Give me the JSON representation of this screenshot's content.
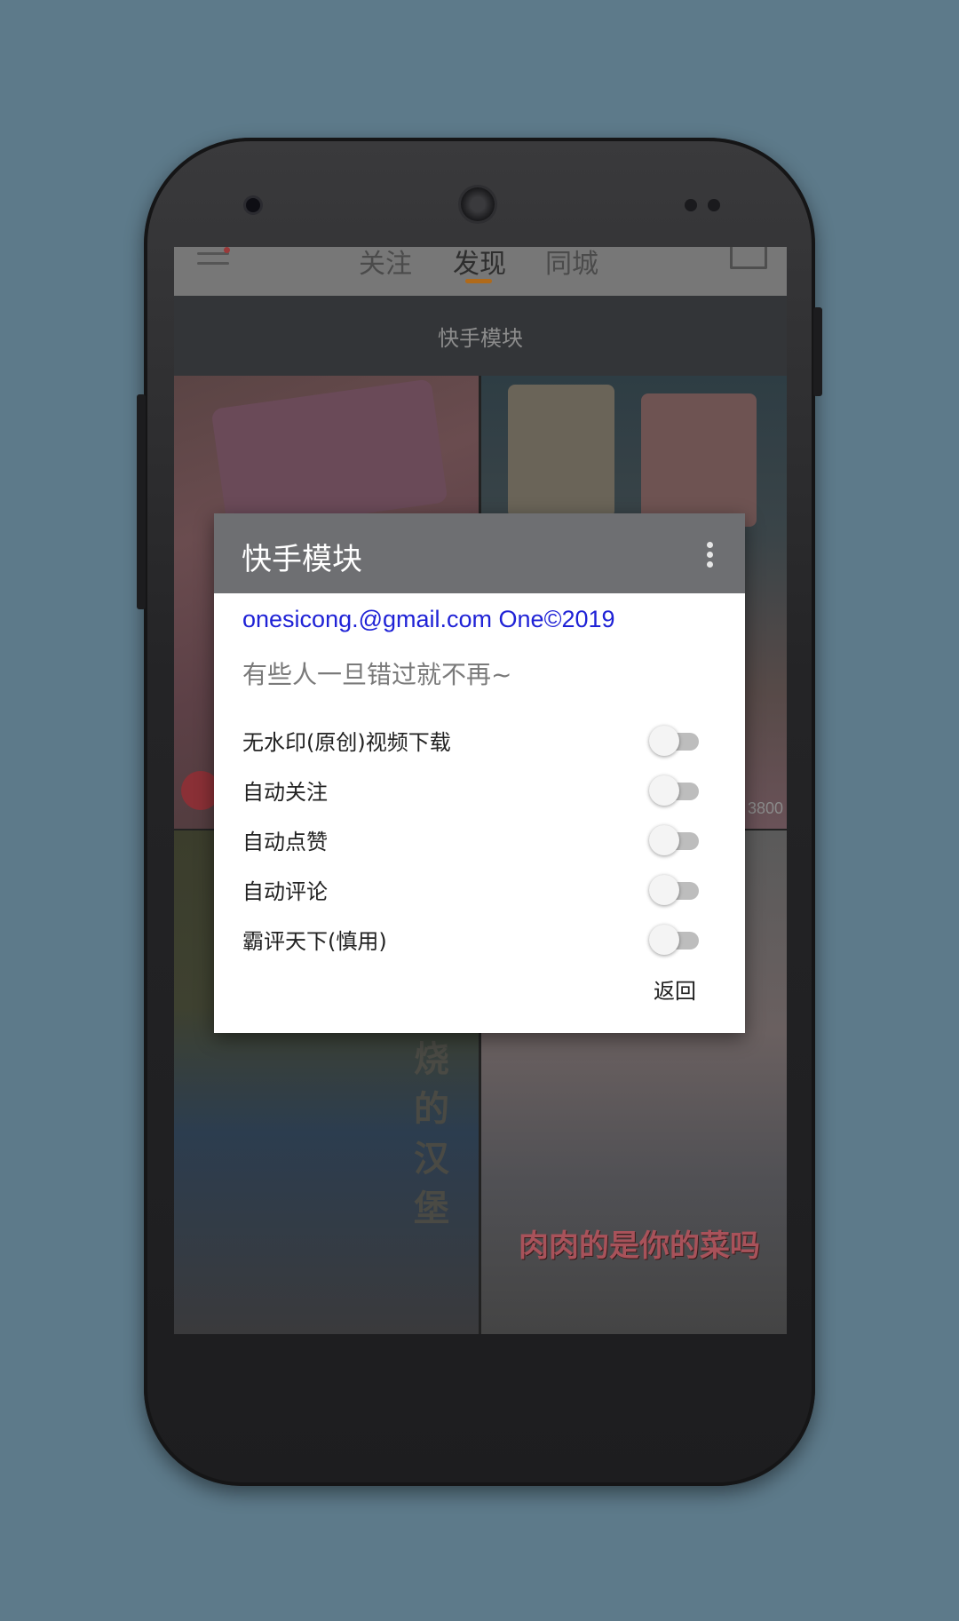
{
  "app_header": {
    "tabs": [
      {
        "label": "关注"
      },
      {
        "label": "发现"
      },
      {
        "label": "同城"
      }
    ],
    "active_tab": "发现"
  },
  "page_title": "快手模块",
  "feed": {
    "caption_hanbao": "烧的汉堡",
    "caption_cai": "肉肉的是你的菜吗",
    "side_count": "3800"
  },
  "dialog": {
    "title": "快手模块",
    "email_line": "onesicong.@gmail.com One©2019",
    "motto": "有些人一旦错过就不再~",
    "options": [
      {
        "label": "无水印(原创)视频下载",
        "enabled": false
      },
      {
        "label": "自动关注",
        "enabled": false
      },
      {
        "label": "自动点赞",
        "enabled": false
      },
      {
        "label": "自动评论",
        "enabled": false
      },
      {
        "label": "霸评天下(慎用)",
        "enabled": false
      }
    ],
    "back_label": "返回"
  },
  "colors": {
    "background": "#5d7a8a",
    "dialog_header": "#6e6f72",
    "email_text": "#1f22d6",
    "tab_indicator": "#b06a1a"
  }
}
